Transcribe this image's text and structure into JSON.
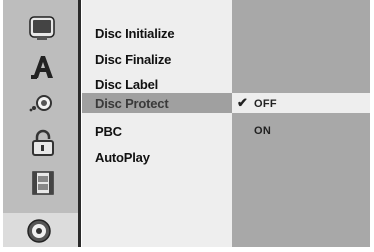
{
  "icon_sidebar": {
    "icons": [
      {
        "name": "monitor-icon"
      },
      {
        "name": "language-icon"
      },
      {
        "name": "audio-icon"
      },
      {
        "name": "lock-icon"
      },
      {
        "name": "film-icon"
      },
      {
        "name": "disc-icon",
        "selected": true
      }
    ]
  },
  "menu": {
    "items": [
      {
        "label": "Disc Initialize"
      },
      {
        "label": "Disc Finalize"
      },
      {
        "label": "Disc Label"
      },
      {
        "label": "Disc Protect",
        "selected": true
      },
      {
        "label": "PBC"
      },
      {
        "label": "AutoPlay"
      }
    ]
  },
  "options": {
    "check_glyph": "✔",
    "items": [
      {
        "label": "OFF",
        "checked": true
      },
      {
        "label": "ON"
      }
    ]
  },
  "colors": {
    "sidebar_bg": "#bdbdbd",
    "menu_bg": "#eeeeee",
    "options_bg": "#a8a8a8",
    "highlight": "#a0a0a0"
  }
}
